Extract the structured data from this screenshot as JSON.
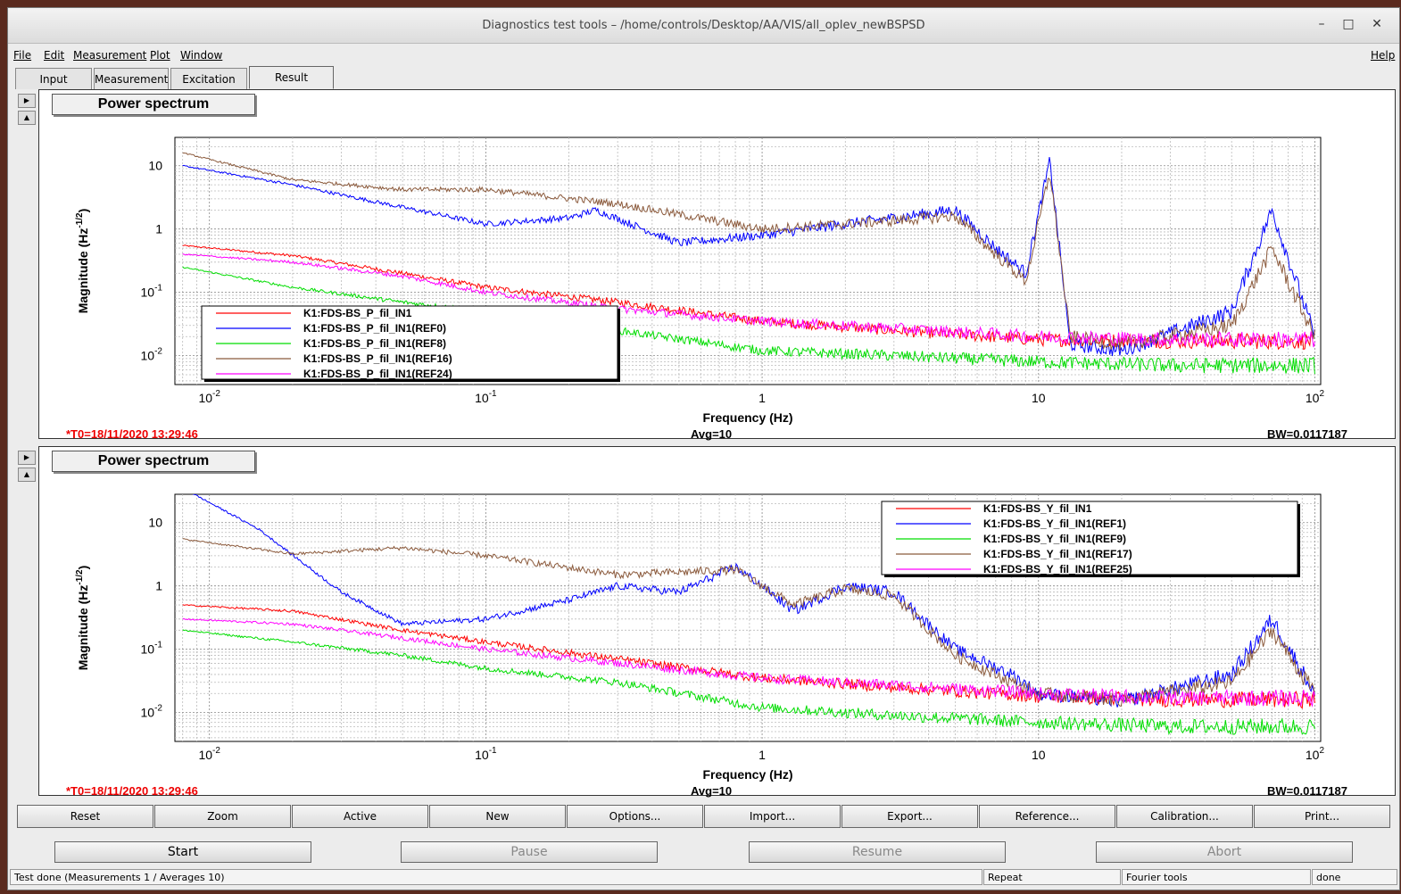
{
  "window": {
    "title": "Diagnostics test tools – /home/controls/Desktop/AA/VIS/all_oplev_newBSPSD",
    "minimize": "–",
    "maximize": "□",
    "close": "✕"
  },
  "menu": {
    "file": "File",
    "edit": "Edit",
    "measurement": "Measurement",
    "plot": "Plot",
    "window": "Window",
    "help": "Help"
  },
  "tabs": [
    {
      "label": "Input"
    },
    {
      "label": "Measurement"
    },
    {
      "label": "Excitation"
    },
    {
      "label": "Result"
    }
  ],
  "panels": [
    {
      "title": "Power spectrum",
      "t0": "*T0=18/11/2020 13:29:46",
      "avg": "Avg=10",
      "bw": "BW=0.0117187",
      "legend": [
        "K1:FDS-BS_P_fil_IN1",
        "K1:FDS-BS_P_fil_IN1(REF0)",
        "K1:FDS-BS_P_fil_IN1(REF8)",
        "K1:FDS-BS_P_fil_IN1(REF16)",
        "K1:FDS-BS_P_fil_IN1(REF24)"
      ]
    },
    {
      "title": "Power spectrum",
      "t0": "*T0=18/11/2020 13:29:46",
      "avg": "Avg=10",
      "bw": "BW=0.0117187",
      "legend": [
        "K1:FDS-BS_Y_fil_IN1",
        "K1:FDS-BS_Y_fil_IN1(REF1)",
        "K1:FDS-BS_Y_fil_IN1(REF9)",
        "K1:FDS-BS_Y_fil_IN1(REF17)",
        "K1:FDS-BS_Y_fil_IN1(REF25)"
      ]
    }
  ],
  "chart_data": [
    {
      "type": "line",
      "title": "Power spectrum",
      "xlabel": "Frequency (Hz)",
      "ylabel": "Magnitude (Hz^-1/2)",
      "xscale": "log",
      "yscale": "log",
      "xlim": [
        0.0075,
        105
      ],
      "ylim": [
        0.0035,
        28
      ],
      "xticks": [
        "10^-2",
        "10^-1",
        "1",
        "10",
        "10^2"
      ],
      "yticks": [
        "10^-2",
        "10^-1",
        "1",
        "10"
      ],
      "grid": true,
      "legend_position": "bottom-left",
      "series": [
        {
          "name": "K1:FDS-BS_P_fil_IN1",
          "color": "#ff0000",
          "x": [
            0.008,
            0.02,
            0.05,
            0.1,
            0.3,
            1,
            3,
            10,
            30,
            100
          ],
          "y": [
            0.55,
            0.38,
            0.2,
            0.12,
            0.07,
            0.035,
            0.025,
            0.018,
            0.017,
            0.017
          ]
        },
        {
          "name": "K1:FDS-BS_P_fil_IN1(REF0)",
          "color": "#0000ff",
          "x": [
            0.008,
            0.02,
            0.05,
            0.1,
            0.2,
            0.25,
            0.5,
            1,
            2,
            5,
            7,
            9,
            11,
            13,
            20,
            50,
            70,
            100
          ],
          "y": [
            10,
            5,
            2.2,
            1.2,
            1.5,
            2,
            0.6,
            0.8,
            1.2,
            2,
            0.5,
            0.2,
            12,
            0.015,
            0.012,
            0.05,
            2,
            0.02
          ]
        },
        {
          "name": "K1:FDS-BS_P_fil_IN1(REF8)",
          "color": "#00dd00",
          "x": [
            0.008,
            0.02,
            0.05,
            0.1,
            0.3,
            1,
            3,
            10,
            30,
            100
          ],
          "y": [
            0.25,
            0.12,
            0.07,
            0.05,
            0.025,
            0.012,
            0.01,
            0.008,
            0.007,
            0.007
          ]
        },
        {
          "name": "K1:FDS-BS_P_fil_IN1(REF16)",
          "color": "#8b5a3c",
          "x": [
            0.008,
            0.02,
            0.05,
            0.1,
            0.3,
            1,
            2,
            5,
            7,
            9,
            11,
            13,
            20,
            50,
            70,
            100
          ],
          "y": [
            16,
            6,
            4.2,
            4.2,
            2.5,
            1,
            1.2,
            1.6,
            0.4,
            0.15,
            8,
            0.02,
            0.015,
            0.03,
            0.5,
            0.02
          ]
        },
        {
          "name": "K1:FDS-BS_P_fil_IN1(REF24)",
          "color": "#ff00ff",
          "x": [
            0.008,
            0.02,
            0.05,
            0.1,
            0.3,
            1,
            3,
            10,
            30,
            100
          ],
          "y": [
            0.4,
            0.3,
            0.18,
            0.1,
            0.055,
            0.035,
            0.027,
            0.02,
            0.018,
            0.018
          ]
        }
      ]
    },
    {
      "type": "line",
      "title": "Power spectrum",
      "xlabel": "Frequency (Hz)",
      "ylabel": "Magnitude (Hz^-1/2)",
      "xscale": "log",
      "yscale": "log",
      "xlim": [
        0.0075,
        105
      ],
      "ylim": [
        0.0035,
        28
      ],
      "xticks": [
        "10^-2",
        "10^-1",
        "1",
        "10",
        "10^2"
      ],
      "yticks": [
        "10^-2",
        "10^-1",
        "1",
        "10"
      ],
      "grid": true,
      "legend_position": "top-right",
      "series": [
        {
          "name": "K1:FDS-BS_Y_fil_IN1",
          "color": "#ff0000",
          "x": [
            0.008,
            0.02,
            0.05,
            0.1,
            0.3,
            1,
            3,
            10,
            30,
            100
          ],
          "y": [
            0.5,
            0.4,
            0.2,
            0.13,
            0.07,
            0.035,
            0.025,
            0.018,
            0.016,
            0.016
          ]
        },
        {
          "name": "K1:FDS-BS_Y_fil_IN1(REF1)",
          "color": "#0000ff",
          "x": [
            0.008,
            0.015,
            0.03,
            0.05,
            0.1,
            0.2,
            0.3,
            0.5,
            0.8,
            1,
            1.3,
            2,
            3,
            5,
            8,
            10,
            20,
            50,
            70,
            100
          ],
          "y": [
            35,
            8,
            0.8,
            0.25,
            0.3,
            0.6,
            1,
            0.8,
            2,
            1,
            0.4,
            1,
            0.8,
            0.1,
            0.04,
            0.02,
            0.015,
            0.04,
            0.3,
            0.02
          ]
        },
        {
          "name": "K1:FDS-BS_Y_fil_IN1(REF9)",
          "color": "#00dd00",
          "x": [
            0.008,
            0.02,
            0.05,
            0.1,
            0.3,
            1,
            3,
            10,
            30,
            100
          ],
          "y": [
            0.2,
            0.13,
            0.08,
            0.05,
            0.03,
            0.012,
            0.009,
            0.007,
            0.006,
            0.006
          ]
        },
        {
          "name": "K1:FDS-BS_Y_fil_IN1(REF17)",
          "color": "#8b5a3c",
          "x": [
            0.008,
            0.02,
            0.05,
            0.1,
            0.3,
            0.8,
            1,
            1.3,
            2,
            3,
            5,
            8,
            10,
            20,
            50,
            70,
            100
          ],
          "y": [
            5.5,
            3.2,
            4,
            3,
            1.5,
            1.8,
            1,
            0.5,
            0.9,
            0.7,
            0.08,
            0.03,
            0.02,
            0.016,
            0.03,
            0.2,
            0.02
          ]
        },
        {
          "name": "K1:FDS-BS_Y_fil_IN1(REF25)",
          "color": "#ff00ff",
          "x": [
            0.008,
            0.02,
            0.05,
            0.1,
            0.3,
            1,
            3,
            10,
            30,
            100
          ],
          "y": [
            0.3,
            0.25,
            0.15,
            0.1,
            0.06,
            0.035,
            0.027,
            0.02,
            0.017,
            0.017
          ]
        }
      ]
    }
  ],
  "toolbar": [
    "Reset",
    "Zoom",
    "Active",
    "New",
    "Options...",
    "Import...",
    "Export...",
    "Reference...",
    "Calibration...",
    "Print..."
  ],
  "controls": {
    "start": "Start",
    "pause": "Pause",
    "resume": "Resume",
    "abort": "Abort"
  },
  "status": {
    "main": "Test done (Measurements 1 / Averages 10)",
    "repeat": "Repeat",
    "fourier": "Fourier tools",
    "done": "done"
  }
}
